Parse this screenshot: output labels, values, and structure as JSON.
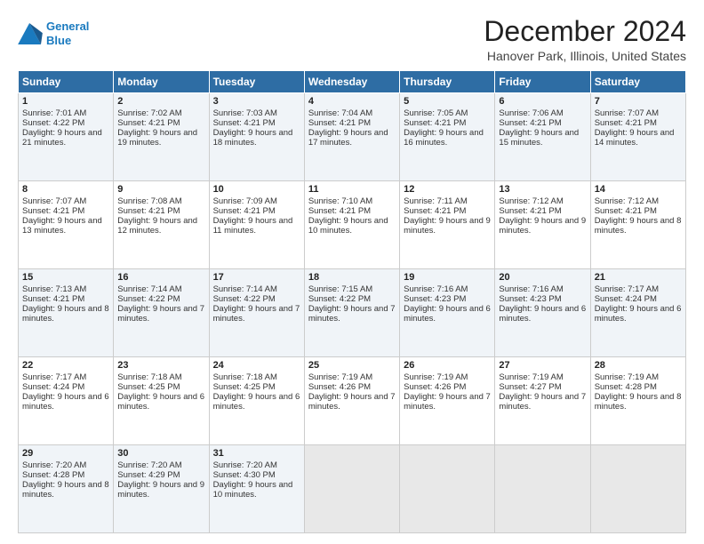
{
  "logo": {
    "line1": "General",
    "line2": "Blue"
  },
  "title": "December 2024",
  "subtitle": "Hanover Park, Illinois, United States",
  "days_of_week": [
    "Sunday",
    "Monday",
    "Tuesday",
    "Wednesday",
    "Thursday",
    "Friday",
    "Saturday"
  ],
  "weeks": [
    [
      {
        "day": "1",
        "sunrise": "Sunrise: 7:01 AM",
        "sunset": "Sunset: 4:22 PM",
        "daylight": "Daylight: 9 hours and 21 minutes."
      },
      {
        "day": "2",
        "sunrise": "Sunrise: 7:02 AM",
        "sunset": "Sunset: 4:21 PM",
        "daylight": "Daylight: 9 hours and 19 minutes."
      },
      {
        "day": "3",
        "sunrise": "Sunrise: 7:03 AM",
        "sunset": "Sunset: 4:21 PM",
        "daylight": "Daylight: 9 hours and 18 minutes."
      },
      {
        "day": "4",
        "sunrise": "Sunrise: 7:04 AM",
        "sunset": "Sunset: 4:21 PM",
        "daylight": "Daylight: 9 hours and 17 minutes."
      },
      {
        "day": "5",
        "sunrise": "Sunrise: 7:05 AM",
        "sunset": "Sunset: 4:21 PM",
        "daylight": "Daylight: 9 hours and 16 minutes."
      },
      {
        "day": "6",
        "sunrise": "Sunrise: 7:06 AM",
        "sunset": "Sunset: 4:21 PM",
        "daylight": "Daylight: 9 hours and 15 minutes."
      },
      {
        "day": "7",
        "sunrise": "Sunrise: 7:07 AM",
        "sunset": "Sunset: 4:21 PM",
        "daylight": "Daylight: 9 hours and 14 minutes."
      }
    ],
    [
      {
        "day": "8",
        "sunrise": "Sunrise: 7:07 AM",
        "sunset": "Sunset: 4:21 PM",
        "daylight": "Daylight: 9 hours and 13 minutes."
      },
      {
        "day": "9",
        "sunrise": "Sunrise: 7:08 AM",
        "sunset": "Sunset: 4:21 PM",
        "daylight": "Daylight: 9 hours and 12 minutes."
      },
      {
        "day": "10",
        "sunrise": "Sunrise: 7:09 AM",
        "sunset": "Sunset: 4:21 PM",
        "daylight": "Daylight: 9 hours and 11 minutes."
      },
      {
        "day": "11",
        "sunrise": "Sunrise: 7:10 AM",
        "sunset": "Sunset: 4:21 PM",
        "daylight": "Daylight: 9 hours and 10 minutes."
      },
      {
        "day": "12",
        "sunrise": "Sunrise: 7:11 AM",
        "sunset": "Sunset: 4:21 PM",
        "daylight": "Daylight: 9 hours and 9 minutes."
      },
      {
        "day": "13",
        "sunrise": "Sunrise: 7:12 AM",
        "sunset": "Sunset: 4:21 PM",
        "daylight": "Daylight: 9 hours and 9 minutes."
      },
      {
        "day": "14",
        "sunrise": "Sunrise: 7:12 AM",
        "sunset": "Sunset: 4:21 PM",
        "daylight": "Daylight: 9 hours and 8 minutes."
      }
    ],
    [
      {
        "day": "15",
        "sunrise": "Sunrise: 7:13 AM",
        "sunset": "Sunset: 4:21 PM",
        "daylight": "Daylight: 9 hours and 8 minutes."
      },
      {
        "day": "16",
        "sunrise": "Sunrise: 7:14 AM",
        "sunset": "Sunset: 4:22 PM",
        "daylight": "Daylight: 9 hours and 7 minutes."
      },
      {
        "day": "17",
        "sunrise": "Sunrise: 7:14 AM",
        "sunset": "Sunset: 4:22 PM",
        "daylight": "Daylight: 9 hours and 7 minutes."
      },
      {
        "day": "18",
        "sunrise": "Sunrise: 7:15 AM",
        "sunset": "Sunset: 4:22 PM",
        "daylight": "Daylight: 9 hours and 7 minutes."
      },
      {
        "day": "19",
        "sunrise": "Sunrise: 7:16 AM",
        "sunset": "Sunset: 4:23 PM",
        "daylight": "Daylight: 9 hours and 6 minutes."
      },
      {
        "day": "20",
        "sunrise": "Sunrise: 7:16 AM",
        "sunset": "Sunset: 4:23 PM",
        "daylight": "Daylight: 9 hours and 6 minutes."
      },
      {
        "day": "21",
        "sunrise": "Sunrise: 7:17 AM",
        "sunset": "Sunset: 4:24 PM",
        "daylight": "Daylight: 9 hours and 6 minutes."
      }
    ],
    [
      {
        "day": "22",
        "sunrise": "Sunrise: 7:17 AM",
        "sunset": "Sunset: 4:24 PM",
        "daylight": "Daylight: 9 hours and 6 minutes."
      },
      {
        "day": "23",
        "sunrise": "Sunrise: 7:18 AM",
        "sunset": "Sunset: 4:25 PM",
        "daylight": "Daylight: 9 hours and 6 minutes."
      },
      {
        "day": "24",
        "sunrise": "Sunrise: 7:18 AM",
        "sunset": "Sunset: 4:25 PM",
        "daylight": "Daylight: 9 hours and 6 minutes."
      },
      {
        "day": "25",
        "sunrise": "Sunrise: 7:19 AM",
        "sunset": "Sunset: 4:26 PM",
        "daylight": "Daylight: 9 hours and 7 minutes."
      },
      {
        "day": "26",
        "sunrise": "Sunrise: 7:19 AM",
        "sunset": "Sunset: 4:26 PM",
        "daylight": "Daylight: 9 hours and 7 minutes."
      },
      {
        "day": "27",
        "sunrise": "Sunrise: 7:19 AM",
        "sunset": "Sunset: 4:27 PM",
        "daylight": "Daylight: 9 hours and 7 minutes."
      },
      {
        "day": "28",
        "sunrise": "Sunrise: 7:19 AM",
        "sunset": "Sunset: 4:28 PM",
        "daylight": "Daylight: 9 hours and 8 minutes."
      }
    ],
    [
      {
        "day": "29",
        "sunrise": "Sunrise: 7:20 AM",
        "sunset": "Sunset: 4:28 PM",
        "daylight": "Daylight: 9 hours and 8 minutes."
      },
      {
        "day": "30",
        "sunrise": "Sunrise: 7:20 AM",
        "sunset": "Sunset: 4:29 PM",
        "daylight": "Daylight: 9 hours and 9 minutes."
      },
      {
        "day": "31",
        "sunrise": "Sunrise: 7:20 AM",
        "sunset": "Sunset: 4:30 PM",
        "daylight": "Daylight: 9 hours and 10 minutes."
      },
      null,
      null,
      null,
      null
    ]
  ]
}
